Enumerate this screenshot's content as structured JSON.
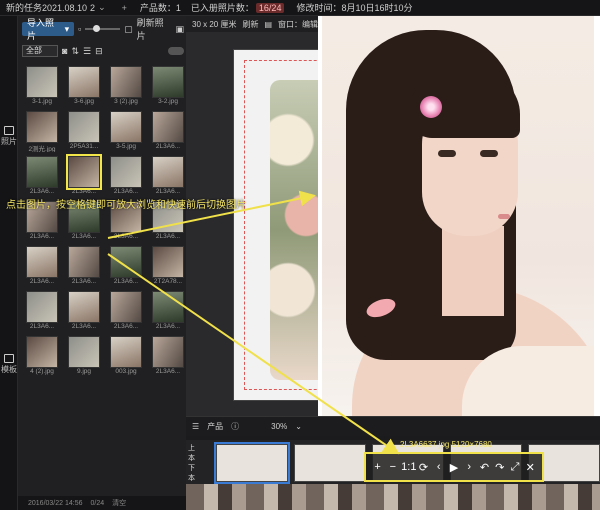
{
  "topbar": {
    "task": "新的任务2021.08.10",
    "task_num": "2",
    "products_label": "产品数：",
    "products_value": "1",
    "used_label": "已入册照片数：",
    "used_value": "16/24",
    "modified_label": "修改时间：",
    "modified_value": "8月10日16时10分"
  },
  "rail": {
    "photos": "照片",
    "templates": "模板"
  },
  "panel": {
    "import": "导入照片",
    "refresh": "刷新照片",
    "filter": "全部",
    "thumbs": [
      "3-1.jpg",
      "3-6.jpg",
      "3 (2).jpg",
      "3-2.jpg",
      "2测光.jpg",
      "2P5A31...",
      "3-5.jpg",
      "2L3A6...",
      "2L3A6...",
      "2L3A6...",
      "2L3A6...",
      "2L3A6...",
      "2L3A6...",
      "2L3A6...",
      "2L3A6...",
      "2L3A6...",
      "2L3A6...",
      "2L3A6...",
      "2L3A6...",
      "2T2A78...",
      "2L3A6...",
      "2L3A6...",
      "2L3A6...",
      "2L3A6...",
      "4 (2).jpg",
      "9.jpg",
      "003.jpg",
      "2L3A6..."
    ],
    "status_time": "2016/03/22 14:56",
    "status_count": "0/24",
    "status_action": "清空"
  },
  "editor": {
    "size": "30 x 20 厘米",
    "refresh": "刷新",
    "window": "窗口：编辑模式"
  },
  "products": {
    "label": "产品",
    "zoom": "30%",
    "tabs": [
      "上",
      "本",
      "下",
      "本"
    ]
  },
  "viewer": {
    "info": "2L3A6637.jpg 5120×7680",
    "controls": [
      "+",
      "−",
      "1:1",
      "⟳",
      "‹",
      "▶",
      "›",
      "↶",
      "↷",
      "⤢",
      "✕"
    ]
  },
  "callout": "点击图片，按空格键即可放大浏览和快速前后切换图片",
  "colors": {
    "accent": "#f0e04a",
    "import": "#2d5b8a",
    "highlight": "#6b2b2b"
  }
}
